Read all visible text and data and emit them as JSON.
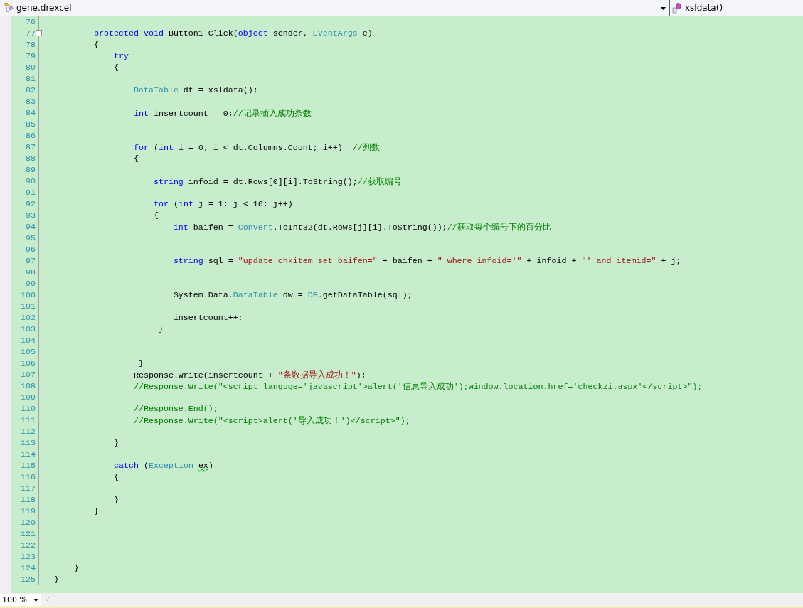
{
  "navigation_bar": {
    "type_dropdown": "gene.drexcel",
    "member_dropdown": "xsldata()"
  },
  "code_lines": [
    {
      "number": "76"
    },
    {
      "number": "77",
      "expanded": true,
      "tokens": [
        {
          "kind": "keyword",
          "text": "        protected void"
        },
        {
          "kind": "plain",
          "text": " Button1_Click("
        },
        {
          "kind": "keyword",
          "text": "object"
        },
        {
          "kind": "plain",
          "text": " sender, "
        },
        {
          "kind": "type",
          "text": "EventArgs"
        },
        {
          "kind": "plain",
          "text": " e)"
        }
      ]
    },
    {
      "number": "78",
      "tokens": [
        {
          "kind": "plain",
          "text": "        {"
        }
      ]
    },
    {
      "number": "79",
      "tokens": [
        {
          "kind": "keyword",
          "text": "            try"
        }
      ]
    },
    {
      "number": "80",
      "tokens": [
        {
          "kind": "plain",
          "text": "            {"
        }
      ]
    },
    {
      "number": "81"
    },
    {
      "number": "82",
      "tokens": [
        {
          "kind": "type",
          "text": "                DataTable"
        },
        {
          "kind": "plain",
          "text": " dt = xsldata();"
        }
      ]
    },
    {
      "number": "83"
    },
    {
      "number": "84",
      "tokens": [
        {
          "kind": "keyword",
          "text": "                int"
        },
        {
          "kind": "plain",
          "text": " insertcount = 0;"
        },
        {
          "kind": "comment",
          "text": "//记录插入成功条数"
        }
      ]
    },
    {
      "number": "85"
    },
    {
      "number": "86"
    },
    {
      "number": "87",
      "tokens": [
        {
          "kind": "keyword",
          "text": "                for"
        },
        {
          "kind": "plain",
          "text": " ("
        },
        {
          "kind": "keyword",
          "text": "int"
        },
        {
          "kind": "plain",
          "text": " i = 0; i < dt.Columns.Count; i++)  "
        },
        {
          "kind": "comment",
          "text": "//列数"
        }
      ]
    },
    {
      "number": "88",
      "tokens": [
        {
          "kind": "plain",
          "text": "                {"
        }
      ]
    },
    {
      "number": "89"
    },
    {
      "number": "90",
      "tokens": [
        {
          "kind": "keyword",
          "text": "                    string"
        },
        {
          "kind": "plain",
          "text": " infoid = dt.Rows[0][i].ToString();"
        },
        {
          "kind": "comment",
          "text": "//获取编号"
        }
      ]
    },
    {
      "number": "91"
    },
    {
      "number": "92",
      "tokens": [
        {
          "kind": "keyword",
          "text": "                    for"
        },
        {
          "kind": "plain",
          "text": " ("
        },
        {
          "kind": "keyword",
          "text": "int"
        },
        {
          "kind": "plain",
          "text": " j = 1; j < 16; j++)"
        }
      ]
    },
    {
      "number": "93",
      "tokens": [
        {
          "kind": "plain",
          "text": "                    {"
        }
      ]
    },
    {
      "number": "94",
      "tokens": [
        {
          "kind": "keyword",
          "text": "                        int"
        },
        {
          "kind": "plain",
          "text": " baifen = "
        },
        {
          "kind": "type",
          "text": "Convert"
        },
        {
          "kind": "plain",
          "text": ".ToInt32(dt.Rows[j][i].ToString());"
        },
        {
          "kind": "comment",
          "text": "//获取每个编号下的百分比"
        }
      ]
    },
    {
      "number": "95"
    },
    {
      "number": "96"
    },
    {
      "number": "97",
      "tokens": [
        {
          "kind": "keyword",
          "text": "                        string"
        },
        {
          "kind": "plain",
          "text": " sql = "
        },
        {
          "kind": "string",
          "text": "\"update chkitem set baifen=\""
        },
        {
          "kind": "plain",
          "text": " + baifen + "
        },
        {
          "kind": "string",
          "text": "\" where infoid='\""
        },
        {
          "kind": "plain",
          "text": " + infoid + "
        },
        {
          "kind": "string",
          "text": "\"' and itemid=\""
        },
        {
          "kind": "plain",
          "text": " + j;"
        }
      ]
    },
    {
      "number": "98"
    },
    {
      "number": "99"
    },
    {
      "number": "100",
      "tokens": [
        {
          "kind": "plain",
          "text": "                        System.Data."
        },
        {
          "kind": "type",
          "text": "DataTable"
        },
        {
          "kind": "plain",
          "text": " dw = "
        },
        {
          "kind": "type",
          "text": "DB"
        },
        {
          "kind": "plain",
          "text": ".getDataTable(sql);"
        }
      ]
    },
    {
      "number": "101"
    },
    {
      "number": "102",
      "tokens": [
        {
          "kind": "plain",
          "text": "                        insertcount++;"
        }
      ]
    },
    {
      "number": "103",
      "tokens": [
        {
          "kind": "plain",
          "text": "                     }"
        }
      ]
    },
    {
      "number": "104"
    },
    {
      "number": "105"
    },
    {
      "number": "106",
      "tokens": [
        {
          "kind": "plain",
          "text": "                 }"
        }
      ]
    },
    {
      "number": "107",
      "tokens": [
        {
          "kind": "plain",
          "text": "                Response.Write(insertcount + "
        },
        {
          "kind": "string",
          "text": "\"条数据导入成功！\""
        },
        {
          "kind": "plain",
          "text": ");"
        }
      ]
    },
    {
      "number": "108",
      "tokens": [
        {
          "kind": "comment",
          "text": "                //Response.Write(\"<script languge='javascript'>alert('信息导入成功');window.location.href='checkzi.aspx'</script>\");"
        }
      ]
    },
    {
      "number": "109"
    },
    {
      "number": "110",
      "tokens": [
        {
          "kind": "comment",
          "text": "                //Response.End();"
        }
      ]
    },
    {
      "number": "111",
      "tokens": [
        {
          "kind": "comment",
          "text": "                //Response.Write(\"<script>alert('导入成功！')</script>\");"
        }
      ]
    },
    {
      "number": "112"
    },
    {
      "number": "113",
      "tokens": [
        {
          "kind": "plain",
          "text": "            }"
        }
      ]
    },
    {
      "number": "114"
    },
    {
      "number": "115",
      "tokens": [
        {
          "kind": "keyword",
          "text": "            catch"
        },
        {
          "kind": "plain",
          "text": " ("
        },
        {
          "kind": "type",
          "text": "Exception "
        },
        {
          "kind": "warning",
          "text": "ex"
        },
        {
          "kind": "plain",
          "text": ")"
        }
      ]
    },
    {
      "number": "116",
      "tokens": [
        {
          "kind": "plain",
          "text": "            {"
        }
      ]
    },
    {
      "number": "117"
    },
    {
      "number": "118",
      "tokens": [
        {
          "kind": "plain",
          "text": "            }"
        }
      ]
    },
    {
      "number": "119",
      "tokens": [
        {
          "kind": "plain",
          "text": "        }"
        }
      ]
    },
    {
      "number": "120"
    },
    {
      "number": "121"
    },
    {
      "number": "122"
    },
    {
      "number": "123"
    },
    {
      "number": "124",
      "tokens": [
        {
          "kind": "plain",
          "text": "    }"
        }
      ]
    },
    {
      "number": "125",
      "tokens": [
        {
          "kind": "plain",
          "text": "}"
        }
      ]
    }
  ],
  "status_bar": {
    "zoom": "100 %"
  }
}
